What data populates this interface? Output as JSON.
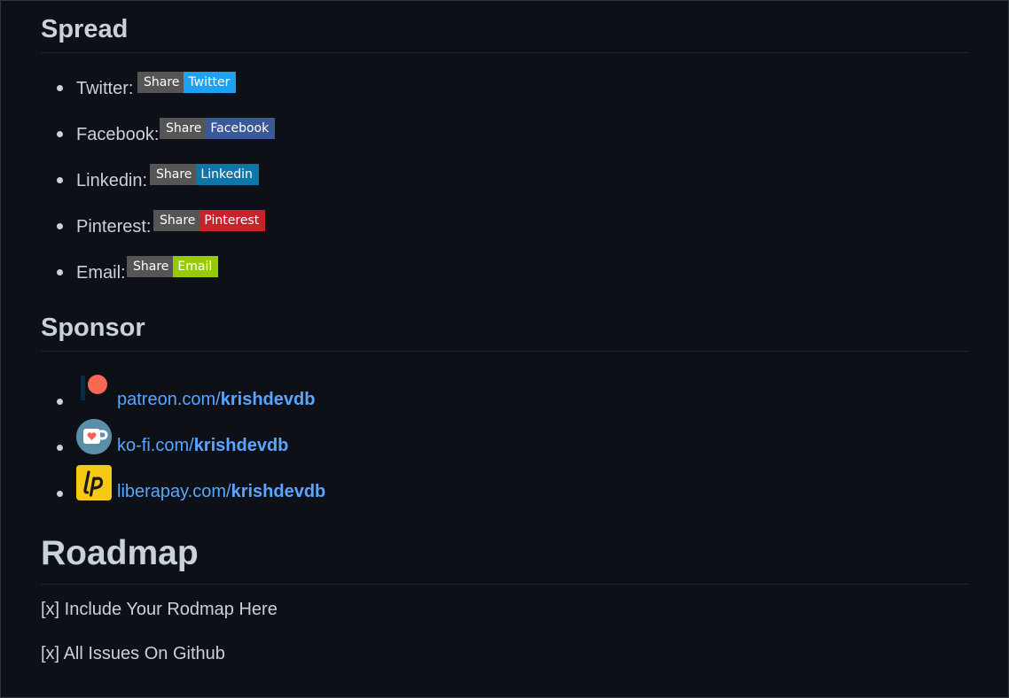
{
  "spread": {
    "heading": "Spread",
    "items": [
      {
        "label": "Twitter:",
        "badge_left": "Share",
        "badge_right": "Twitter",
        "color": "#1da1f2"
      },
      {
        "label": "Facebook:",
        "badge_left": "Share",
        "badge_right": "Facebook",
        "color": "#3b5998"
      },
      {
        "label": "Linkedin:",
        "badge_left": "Share",
        "badge_right": "Linkedin",
        "color": "#0e76a8"
      },
      {
        "label": "Pinterest:",
        "badge_left": "Share",
        "badge_right": "Pinterest",
        "color": "#c8232c"
      },
      {
        "label": "Email:",
        "badge_left": "Share",
        "badge_right": "Email",
        "color": "#97ca00"
      }
    ]
  },
  "sponsor": {
    "heading": "Sponsor",
    "items": [
      {
        "icon": "patreon-icon",
        "link_prefix": "patreon.com/",
        "link_user": "krishdevdb"
      },
      {
        "icon": "kofi-icon",
        "link_prefix": "ko-fi.com/",
        "link_user": "krishdevdb"
      },
      {
        "icon": "liberapay-icon",
        "link_prefix": "liberapay.com/",
        "link_user": "krishdevdb"
      }
    ]
  },
  "roadmap": {
    "heading": "Roadmap",
    "items": [
      "[x] Include Your Rodmap Here",
      "[x] All Issues On Github"
    ]
  },
  "colors": {
    "background": "#0d1117",
    "text": "#c9d1d9",
    "link": "#58a6ff",
    "badge_left": "#555555"
  }
}
